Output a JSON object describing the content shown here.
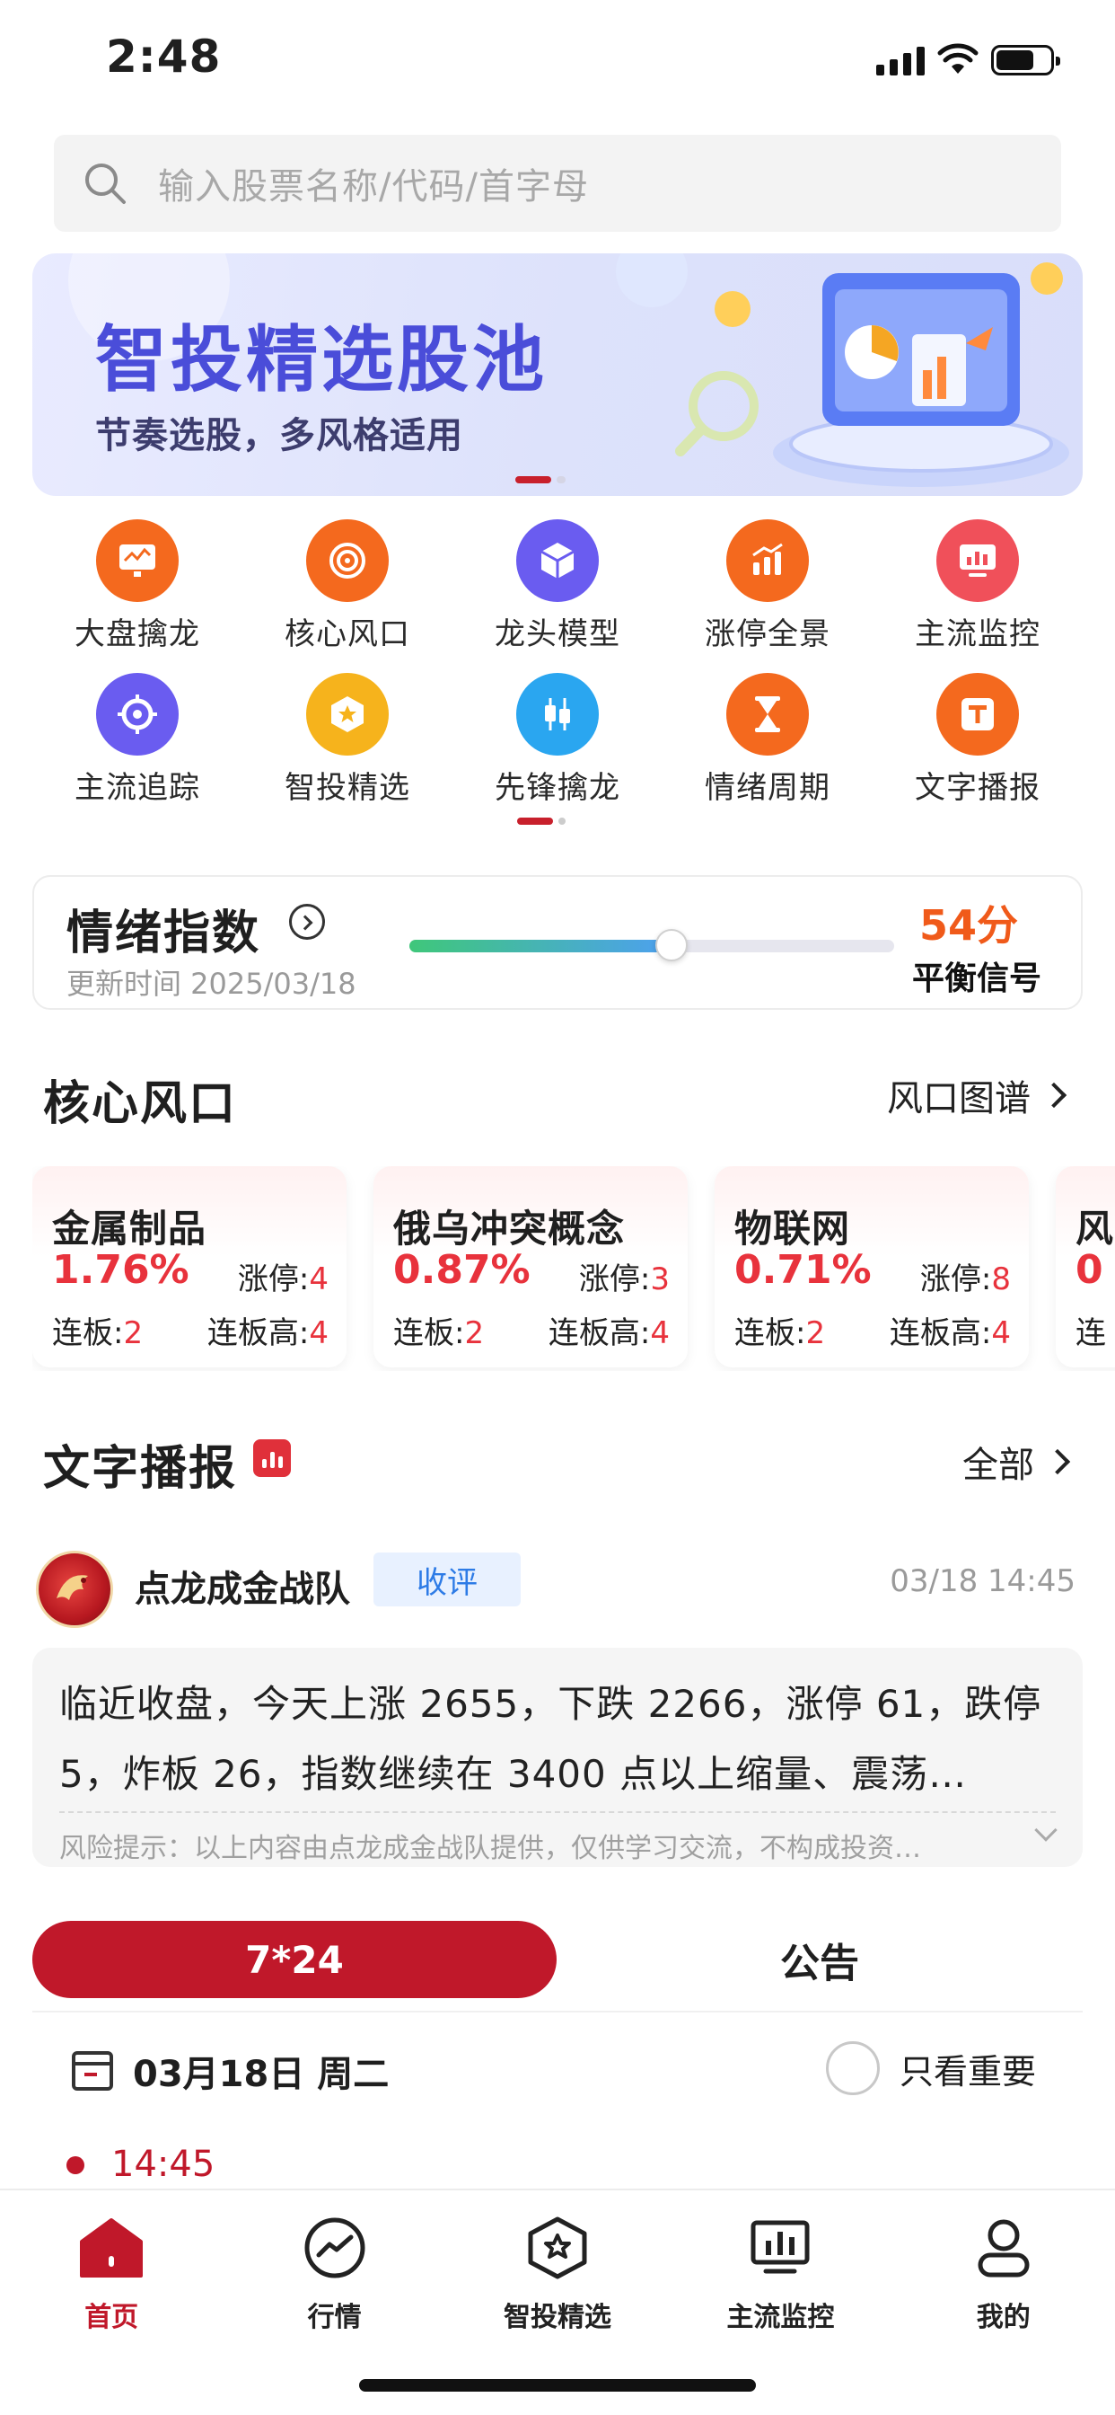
{
  "status_bar": {
    "time": "2:48"
  },
  "search": {
    "placeholder": "输入股票名称/代码/首字母"
  },
  "banner": {
    "title": "智投精选股池",
    "subtitle": "节奏选股，多风格适用"
  },
  "quick_menu": [
    {
      "label": "大盘擒龙",
      "icon": "monitor-chart-icon",
      "color": "#f4691e"
    },
    {
      "label": "核心风口",
      "icon": "target-icon",
      "color": "#f4691e"
    },
    {
      "label": "龙头模型",
      "icon": "cube-icon",
      "color": "#6a5cf0"
    },
    {
      "label": "涨停全景",
      "icon": "bar-chart-up-icon",
      "color": "#f4691e"
    },
    {
      "label": "主流监控",
      "icon": "monitor-bars-icon",
      "color": "#f0505a"
    },
    {
      "label": "主流追踪",
      "icon": "crosshair-icon",
      "color": "#6a5cf0"
    },
    {
      "label": "智投精选",
      "icon": "star-badge-icon",
      "color": "#f6b31c"
    },
    {
      "label": "先锋擒龙",
      "icon": "candlestick-icon",
      "color": "#2aa6f0"
    },
    {
      "label": "情绪周期",
      "icon": "hourglass-icon",
      "color": "#f4691e"
    },
    {
      "label": "文字播报",
      "icon": "text-card-icon",
      "color": "#f4691e"
    }
  ],
  "sentiment": {
    "title": "情绪指数",
    "updated": "更新时间 2025/03/18",
    "score": "54分",
    "score_value": 54,
    "signal": "平衡信号"
  },
  "core": {
    "title": "核心风口",
    "more": "风口图谱",
    "cards": [
      {
        "name": "金属制品",
        "pct": "1.76%",
        "zt_label": "涨停:",
        "zt": "4",
        "lb_label": "连板:",
        "lb": "2",
        "lbh_label": "连板高:",
        "lbh": "4"
      },
      {
        "name": "俄乌冲突概念",
        "pct": "0.87%",
        "zt_label": "涨停:",
        "zt": "3",
        "lb_label": "连板:",
        "lb": "2",
        "lbh_label": "连板高:",
        "lbh": "4"
      },
      {
        "name": "物联网",
        "pct": "0.71%",
        "zt_label": "涨停:",
        "zt": "8",
        "lb_label": "连板:",
        "lb": "2",
        "lbh_label": "连板高:",
        "lbh": "4"
      },
      {
        "name": "风",
        "pct": "0",
        "zt_label": "",
        "zt": "",
        "lb_label": "连",
        "lb": "",
        "lbh_label": "",
        "lbh": ""
      }
    ]
  },
  "broadcast": {
    "title": "文字播报",
    "more": "全部",
    "author": "点龙成金战队",
    "tag": "收评",
    "time": "03/18 14:45",
    "text": "临近收盘，今天上涨 2655，下跌 2266，涨停 61，跌停 5，炸板 26，指数继续在 3400 点以上缩量、震荡…",
    "risk": "风险提示：以上内容由点龙成金战队提供，仅供学习交流，不构成投资…"
  },
  "tabs": {
    "active": "7*24",
    "other": "公告"
  },
  "timeline": {
    "date": "03月18日 周二",
    "important": "只看重要",
    "first_time": "14:45"
  },
  "bottom_nav": [
    {
      "label": "首页",
      "icon": "home-icon",
      "active": true
    },
    {
      "label": "行情",
      "icon": "trend-circle-icon",
      "active": false
    },
    {
      "label": "智投精选",
      "icon": "pentagon-star-icon",
      "active": false
    },
    {
      "label": "主流监控",
      "icon": "monitor-bars-icon",
      "active": false
    },
    {
      "label": "我的",
      "icon": "profile-icon",
      "active": false
    }
  ],
  "colors": {
    "brand_red": "#c0182a",
    "up_red": "#e8323c",
    "score_orange": "#f05a1a",
    "banner_purple": "#4a4dd9"
  }
}
